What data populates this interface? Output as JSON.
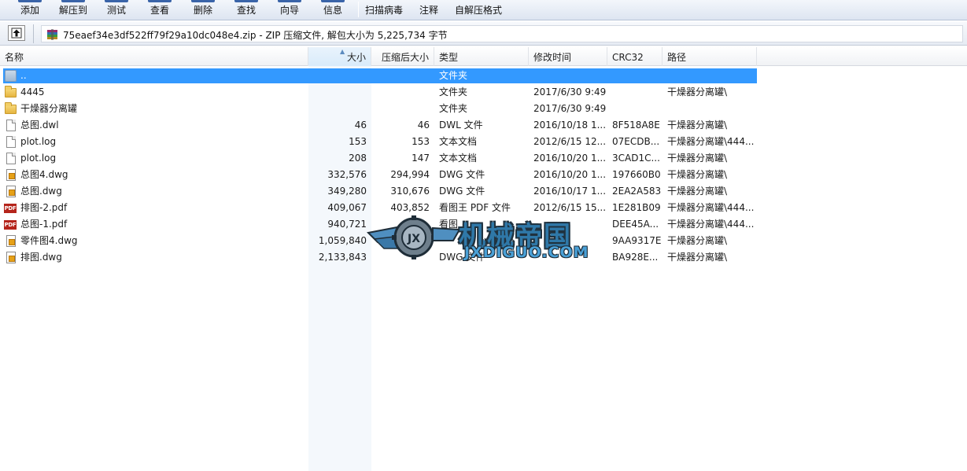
{
  "toolbar": {
    "buttons": [
      "添加",
      "解压到",
      "测试",
      "查看",
      "删除",
      "查找",
      "向导",
      "信息",
      "扫描病毒",
      "注释",
      "自解压格式"
    ]
  },
  "address": {
    "text": "75eaef34e3df522ff79f29a10dc048e4.zip - ZIP 压缩文件, 解包大小为 5,225,734 字节"
  },
  "columns": {
    "name": "名称",
    "size": "大小",
    "packed": "压缩后大小",
    "type": "类型",
    "modified": "修改时间",
    "crc": "CRC32",
    "path": "路径"
  },
  "rows": [
    {
      "icon": "parent-folder-icon",
      "name": "..",
      "size": "",
      "packed": "",
      "type": "文件夹",
      "modified": "",
      "crc": "",
      "path": "",
      "selected": true
    },
    {
      "icon": "folder-icon",
      "name": "4445",
      "size": "",
      "packed": "",
      "type": "文件夹",
      "modified": "2017/6/30 9:49",
      "crc": "",
      "path": "干燥器分离罐\\"
    },
    {
      "icon": "folder-icon",
      "name": "干燥器分离罐",
      "size": "",
      "packed": "",
      "type": "文件夹",
      "modified": "2017/6/30 9:49",
      "crc": "",
      "path": ""
    },
    {
      "icon": "document-icon",
      "name": "总图.dwl",
      "size": "46",
      "packed": "46",
      "type": "DWL 文件",
      "modified": "2016/10/18 1...",
      "crc": "8F518A8E",
      "path": "干燥器分离罐\\"
    },
    {
      "icon": "document-icon",
      "name": "plot.log",
      "size": "153",
      "packed": "153",
      "type": "文本文档",
      "modified": "2012/6/15 12...",
      "crc": "07ECDB...",
      "path": "干燥器分离罐\\444..."
    },
    {
      "icon": "document-icon",
      "name": "plot.log",
      "size": "208",
      "packed": "147",
      "type": "文本文档",
      "modified": "2016/10/20 1...",
      "crc": "3CAD1C...",
      "path": "干燥器分离罐\\"
    },
    {
      "icon": "dwg-file-icon",
      "name": "总图4.dwg",
      "size": "332,576",
      "packed": "294,994",
      "type": "DWG 文件",
      "modified": "2016/10/20 1...",
      "crc": "197660B0",
      "path": "干燥器分离罐\\"
    },
    {
      "icon": "dwg-file-icon",
      "name": "总图.dwg",
      "size": "349,280",
      "packed": "310,676",
      "type": "DWG 文件",
      "modified": "2016/10/17 1...",
      "crc": "2EA2A583",
      "path": "干燥器分离罐\\"
    },
    {
      "icon": "pdf-file-icon",
      "name": "排图-2.pdf",
      "size": "409,067",
      "packed": "403,852",
      "type": "看图王 PDF 文件",
      "modified": "2012/6/15 15...",
      "crc": "1E281B09",
      "path": "干燥器分离罐\\444..."
    },
    {
      "icon": "pdf-file-icon",
      "name": "总图-1.pdf",
      "size": "940,721",
      "packed": "",
      "type": "看图",
      "modified": "",
      "crc": "DEE45A...",
      "path": "干燥器分离罐\\444..."
    },
    {
      "icon": "dwg-file-icon",
      "name": "零件图4.dwg",
      "size": "1,059,840",
      "packed": "",
      "type": "",
      "modified": "",
      "crc": "9AA9317E",
      "path": "干燥器分离罐\\"
    },
    {
      "icon": "dwg-file-icon",
      "name": "排图.dwg",
      "size": "2,133,843",
      "packed": "",
      "type": "DWG 文件",
      "modified": "",
      "crc": "BA928E...",
      "path": "干燥器分离罐\\"
    }
  ],
  "watermark": {
    "cn": "机械帝国",
    "en": "JXDIGUO.COM"
  },
  "colors": {
    "selection": "#3399ff",
    "toolbar_accent": "#3a64a8",
    "watermark_blue": "#2f78a8"
  }
}
